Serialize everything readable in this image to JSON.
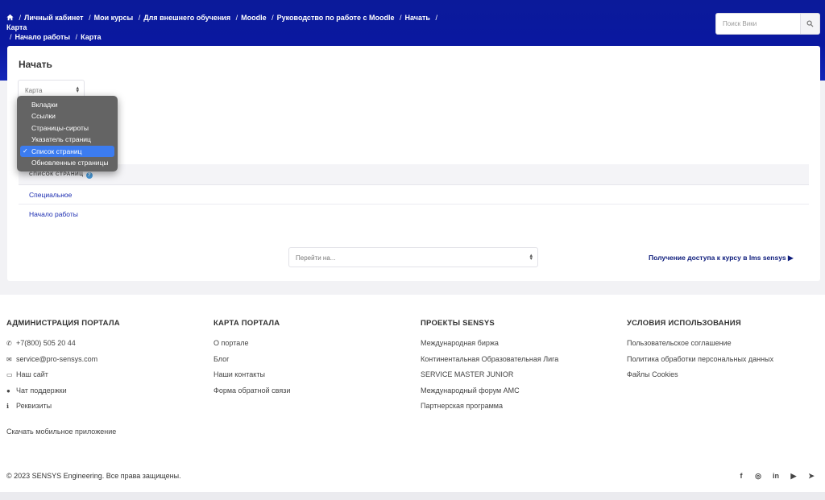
{
  "breadcrumbs": [
    "Личный кабинет",
    "Мои курсы",
    "Для внешнего обучения",
    "Moodle",
    "Руководство по работе с Moodle",
    "Начать",
    "Карта",
    "Начало работы",
    "Карта"
  ],
  "breadcrumb_separator": "/",
  "search": {
    "placeholder": "Поиск Вики"
  },
  "page": {
    "title": "Начать",
    "map_select_value": "Карта",
    "table_header": "СПИСОК СТРАНИЦ",
    "rows": [
      "Специальное",
      "Начало работы"
    ],
    "jump_placeholder": "Перейти на...",
    "next_link": "Получение доступа к курсу в lms sensys ▶"
  },
  "dropdown": {
    "options": [
      "Вкладки",
      "Ссылки",
      "Страницы-сироты",
      "Указатель страниц",
      "Список страниц",
      "Обновленные страницы"
    ],
    "selected": "Список страниц",
    "check_mark": "✓"
  },
  "footer": {
    "columns": [
      {
        "title": "АДМИНИСТРАЦИЯ ПОРТАЛА",
        "items": [
          {
            "icon": "phone-icon",
            "glyph": "✆",
            "label": "+7(800) 505 20 44"
          },
          {
            "icon": "mail-icon",
            "glyph": "✉",
            "label": "service@pro-sensys.com"
          },
          {
            "icon": "laptop-icon",
            "glyph": "▭",
            "label": "Наш сайт"
          },
          {
            "icon": "chat-icon",
            "glyph": "●",
            "label": "Чат поддержки"
          },
          {
            "icon": "info-icon",
            "glyph": "ℹ",
            "label": "Реквизиты"
          }
        ]
      },
      {
        "title": "КАРТА ПОРТАЛА",
        "items": [
          {
            "label": "О портале"
          },
          {
            "label": "Блог"
          },
          {
            "label": "Наши контакты"
          },
          {
            "label": "Форма обратной связи"
          }
        ]
      },
      {
        "title": "ПРОЕКТЫ SENSYS",
        "items": [
          {
            "label": "Международная биржа"
          },
          {
            "label": "Континентальная Образовательная Лига"
          },
          {
            "label": "SERVICE MASTER JUNIOR"
          },
          {
            "label": "Международный форум АМС"
          },
          {
            "label": "Партнерская программа"
          }
        ]
      },
      {
        "title": "УСЛОВИЯ ИСПОЛЬЗОВАНИЯ",
        "items": [
          {
            "label": "Пользовательское соглашение"
          },
          {
            "label": "Политика обработки персональных данных"
          },
          {
            "label": "Файлы Cookies"
          }
        ]
      }
    ],
    "mobile_app": "Скачать мобильное приложение",
    "copyright": "© 2023 SENSYS Engineering. Все права защищены.",
    "social": [
      {
        "name": "facebook-icon",
        "glyph": "f"
      },
      {
        "name": "instagram-icon",
        "glyph": "◎"
      },
      {
        "name": "linkedin-icon",
        "glyph": "in"
      },
      {
        "name": "youtube-icon",
        "glyph": "▶"
      },
      {
        "name": "telegram-icon",
        "glyph": "➤"
      }
    ]
  }
}
